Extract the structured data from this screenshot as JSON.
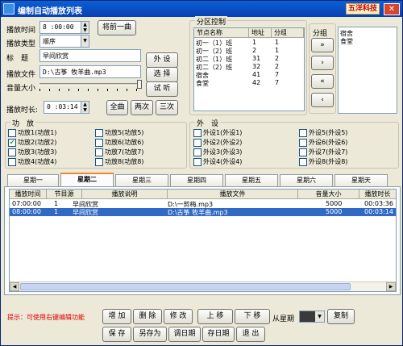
{
  "window": {
    "title": "编制自动播放列表",
    "logo_text": "五洋科技",
    "close_glyph": "✕"
  },
  "left": {
    "play_time_label": "播放时间",
    "play_time_value": "8 :00:00",
    "prev_button": "将前一曲",
    "play_type_label": "播放类型",
    "play_type_value": "顺序",
    "title_label": "标　题",
    "title_value": "早间欣赏",
    "file_label": "播放文件",
    "file_value": "D:\\古筝 牧羊曲.mp3",
    "external_button": "外 设",
    "select_button": "选 择",
    "audition_button": "试 听",
    "volume_label": "音量大小",
    "duration_label": "播放时长:",
    "duration_value": "0 :03:14",
    "full_button": "全曲",
    "twice_button": "两次",
    "thrice_button": "三次"
  },
  "zone_control": {
    "title": "分区控制",
    "headers": [
      "节点名称",
      "地址",
      "分组"
    ],
    "rows": [
      [
        "初一（1）班",
        "1",
        "1"
      ],
      [
        "初一（2）班",
        "2",
        "1"
      ],
      [
        "初二（1）班",
        "31",
        "2"
      ],
      [
        "初二（2）班",
        "32",
        "2"
      ],
      [
        "宿舍",
        "41",
        "7"
      ],
      [
        "食堂",
        "42",
        "7"
      ]
    ],
    "group_label": "分组",
    "group_buttons": [
      "»",
      "›",
      "«",
      "‹"
    ],
    "group_list": [
      "宿舍",
      "食堂"
    ]
  },
  "function": {
    "title": "功　放",
    "items": [
      {
        "label": "功放1(功放1)",
        "checked": false
      },
      {
        "label": "功放2(功放2)",
        "checked": true
      },
      {
        "label": "功放3(功放3)",
        "checked": false
      },
      {
        "label": "功放4(功放4)",
        "checked": false
      },
      {
        "label": "功放5(功放5)",
        "checked": false
      },
      {
        "label": "功放6(功放6)",
        "checked": false
      },
      {
        "label": "功放7(功放7)",
        "checked": false
      },
      {
        "label": "功放8(功放8)",
        "checked": false
      }
    ]
  },
  "external": {
    "title": "外　设",
    "items": [
      {
        "label": "外设1(外设1)"
      },
      {
        "label": "外设2(外设2)"
      },
      {
        "label": "外设3(外设3)"
      },
      {
        "label": "外设4(外设4)"
      },
      {
        "label": "外设5(外设5)"
      },
      {
        "label": "外设6(外设6)"
      },
      {
        "label": "外设7(外设7)"
      },
      {
        "label": "外设8(外设8)"
      }
    ]
  },
  "tabs": [
    "星期一",
    "星期二",
    "星期三",
    "星期四",
    "星期五",
    "星期六",
    "星期天"
  ],
  "active_tab": "星期二",
  "table": {
    "headers": [
      "播放时间",
      "节目源",
      "播放说明",
      "播放文件",
      "音量大小",
      "播放时长"
    ],
    "rows": [
      {
        "cells": [
          "07:00:00",
          "1",
          "早间欣赏",
          "D:\\一剪梅.mp3",
          "5000",
          "00:03:36"
        ],
        "selected": false
      },
      {
        "cells": [
          "08:00:00",
          "1",
          "早间欣赏",
          "D:\\古筝 牧羊曲.mp3",
          "5000",
          "00:03:14"
        ],
        "selected": true
      }
    ]
  },
  "bottom": {
    "hint": "提示：可使用右键编辑功能",
    "add": "增 加",
    "delete": "删 除",
    "modify": "修 改",
    "up": "上 移",
    "down": "下 移",
    "from_week_label": "从星期",
    "copy": "复制",
    "save": "保 存",
    "save_as": "另存为",
    "load_date": "调日期",
    "save_date": "存日期",
    "exit": "退 出"
  },
  "colors": {
    "hint": "#e00000",
    "selection": "#316ac5",
    "titlebar": "#0a5fd8",
    "active_tab_accent": "#e68b2c"
  }
}
